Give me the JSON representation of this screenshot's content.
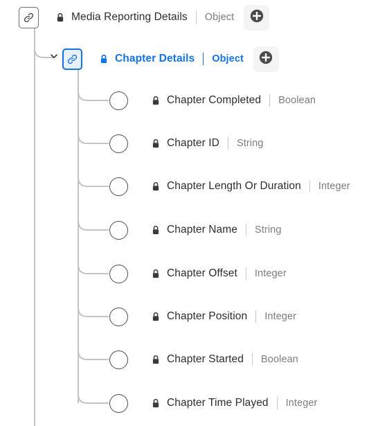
{
  "tree": {
    "root": {
      "icon": "link-icon",
      "lock_icon": "lock-icon",
      "label": "Media Reporting Details",
      "type": "Object",
      "add_label": "+",
      "selected": false
    },
    "child": {
      "icon": "link-icon",
      "lock_icon": "lock-icon",
      "chevron_icon": "chevron-down-icon",
      "label": "Chapter Details",
      "type": "Object",
      "add_label": "+",
      "selected": true
    },
    "fields": [
      {
        "lock_icon": "lock-icon",
        "label": "Chapter Completed",
        "type": "Boolean"
      },
      {
        "lock_icon": "lock-icon",
        "label": "Chapter ID",
        "type": "String"
      },
      {
        "lock_icon": "lock-icon",
        "label": "Chapter Length Or Duration",
        "type": "Integer"
      },
      {
        "lock_icon": "lock-icon",
        "label": "Chapter Name",
        "type": "String"
      },
      {
        "lock_icon": "lock-icon",
        "label": "Chapter Offset",
        "type": "Integer"
      },
      {
        "lock_icon": "lock-icon",
        "label": "Chapter Position",
        "type": "Integer"
      },
      {
        "lock_icon": "lock-icon",
        "label": "Chapter Started",
        "type": "Boolean"
      },
      {
        "lock_icon": "lock-icon",
        "label": "Chapter Time Played",
        "type": "Integer"
      }
    ]
  },
  "colors": {
    "accent": "#1473e6",
    "accent_bg": "#e8f0fd",
    "text": "#2c2c2c",
    "muted": "#7c7c7c",
    "line": "#c4c4c4",
    "plus_fill": "#4b4b4b"
  }
}
